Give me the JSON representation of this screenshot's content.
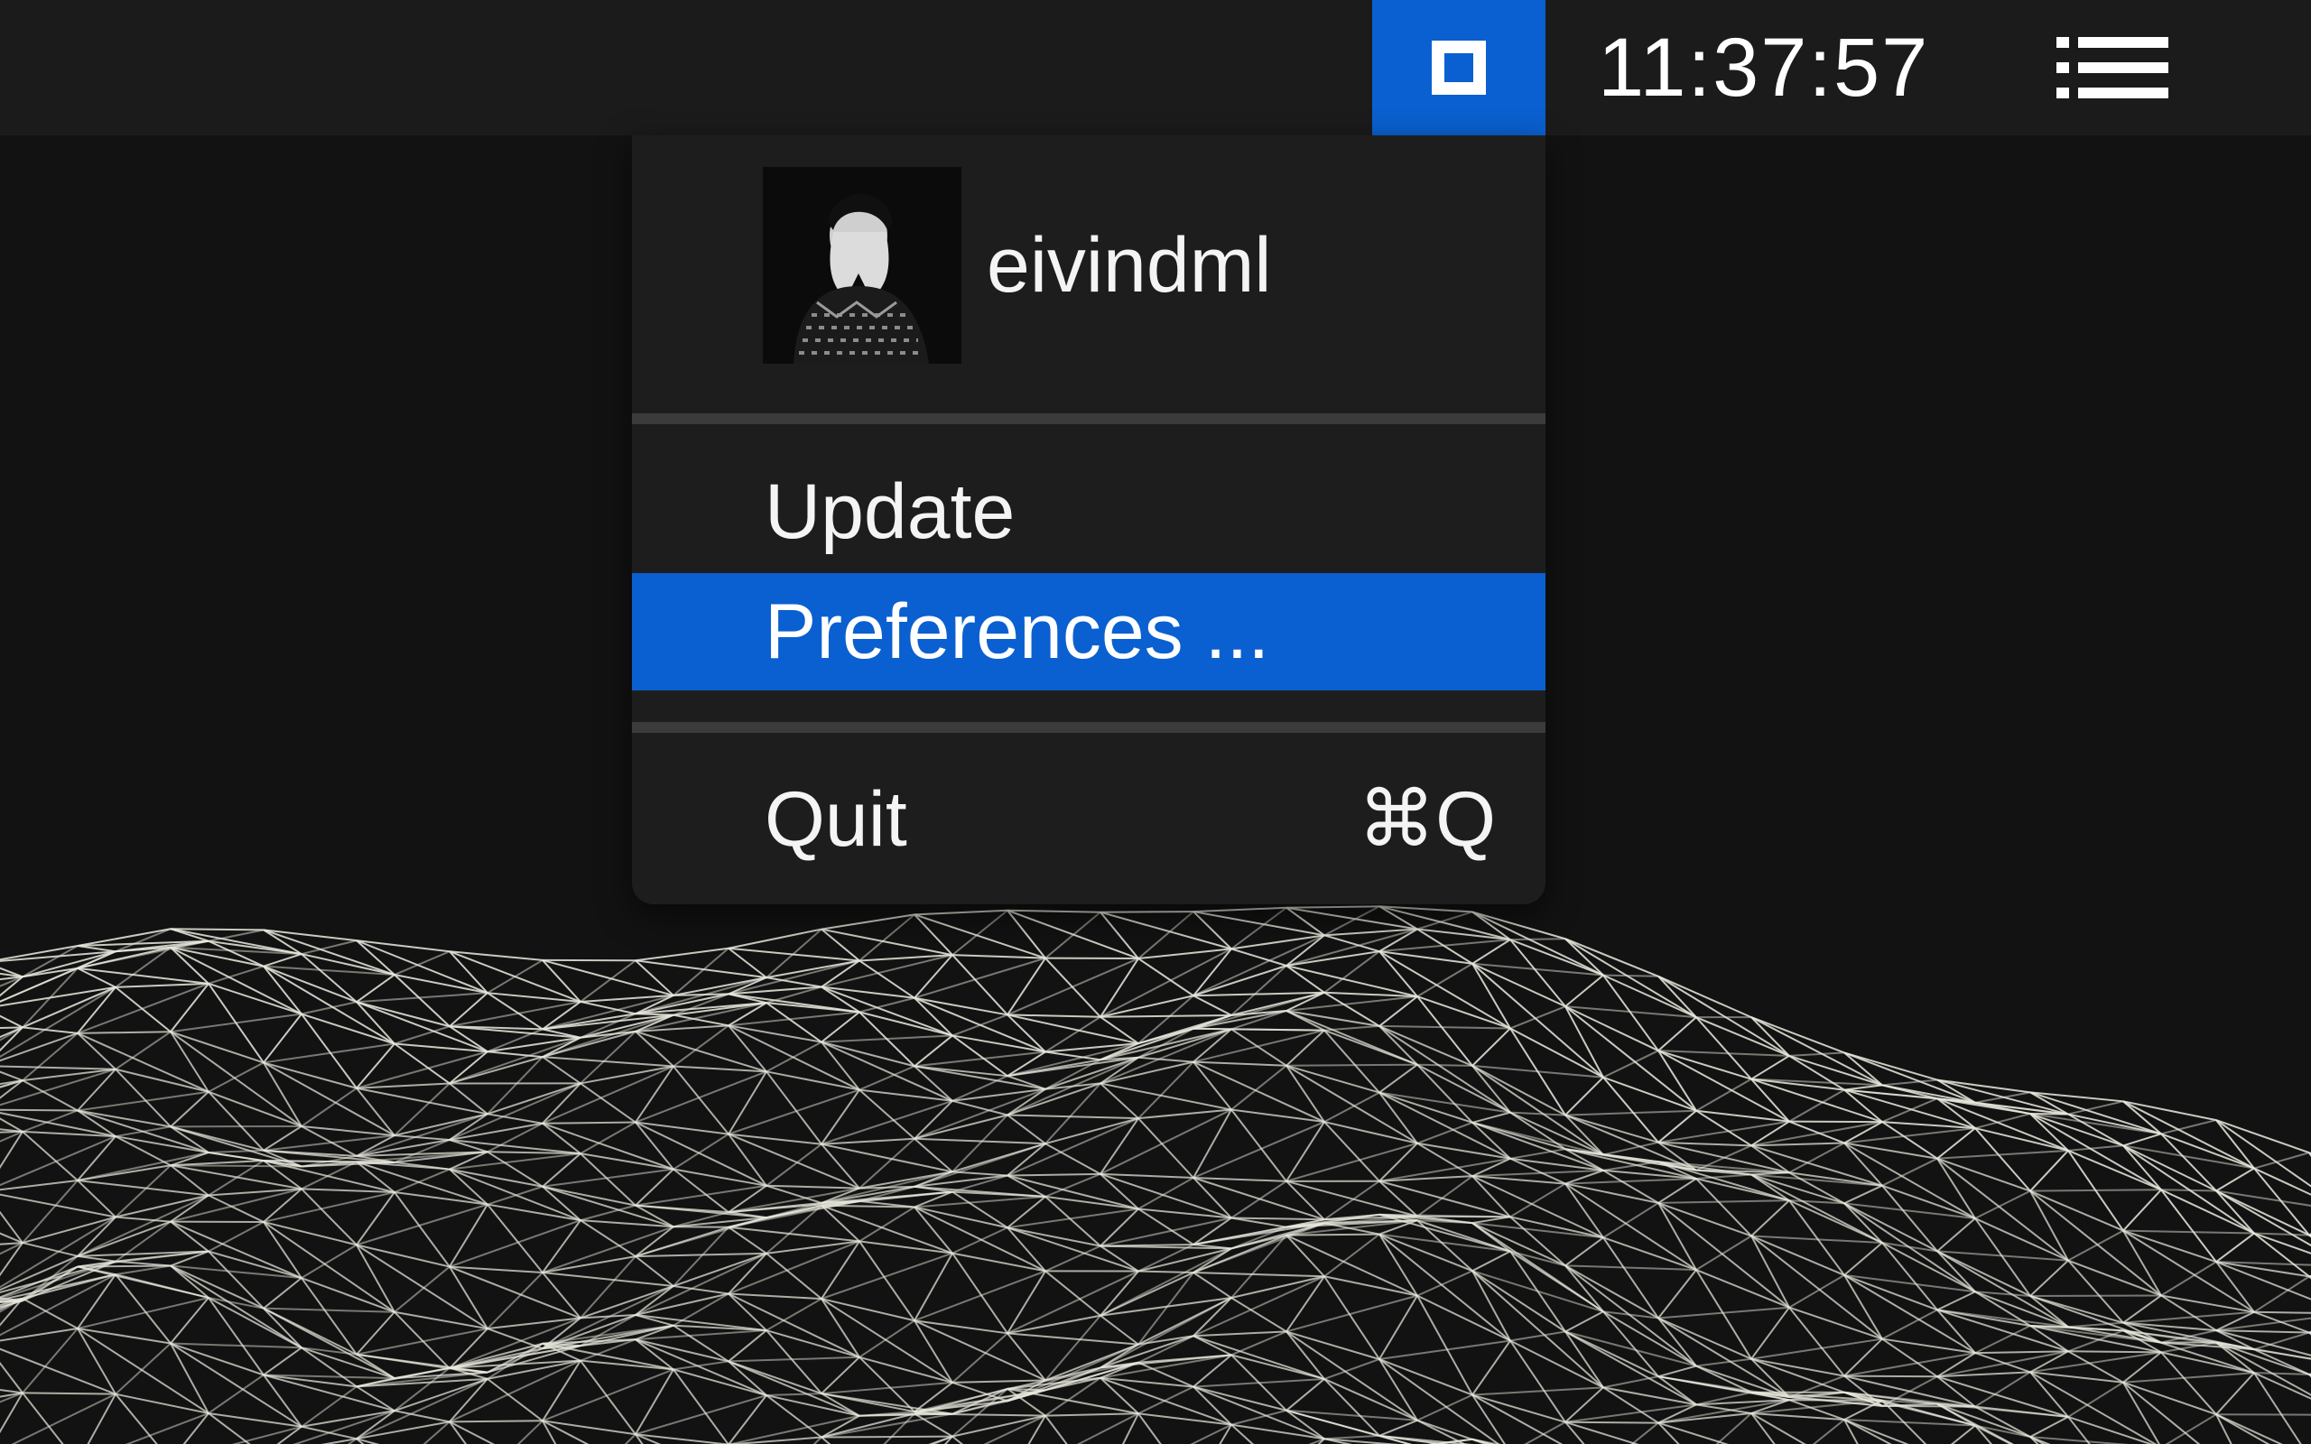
{
  "menubar": {
    "app_icon": "square-icon",
    "clock": "11:37:57",
    "list_icon": "list-icon"
  },
  "menu": {
    "user": {
      "username": "eivindml",
      "avatar_icon": "avatar-photo"
    },
    "items": [
      {
        "label": "Update"
      },
      {
        "label": "Preferences ...",
        "highlighted": true
      },
      {
        "label": "Quit",
        "shortcut": "⌘Q"
      }
    ]
  },
  "colors": {
    "accent": "#0a60d0",
    "menubar": "#1b1b1b",
    "menu_background": "#1d1d1d",
    "desktop": "#121212",
    "wireframe": "#e9e9de"
  },
  "wallpaper": {
    "style": "white wireframe terrain on black"
  }
}
